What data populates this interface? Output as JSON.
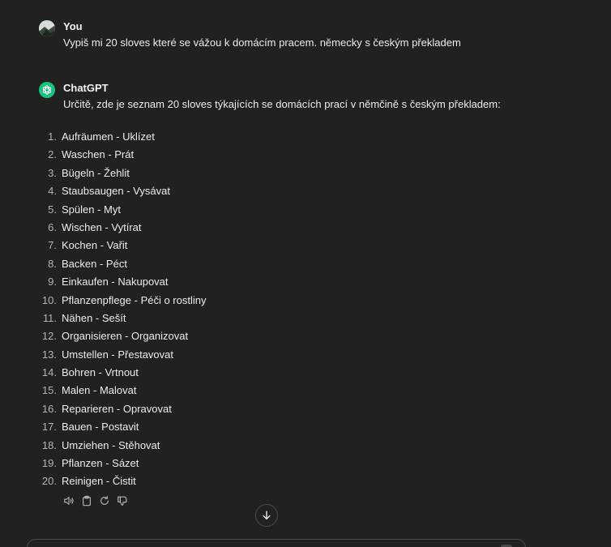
{
  "user_message": {
    "author": "You",
    "text": "Vypiš mi 20 sloves které se vážou k domácím pracem. německy s českým překladem"
  },
  "assistant_message": {
    "author": "ChatGPT",
    "intro": "Určitě, zde je seznam 20 sloves týkajících se domácích prací v němčině s českým překladem:",
    "items": [
      {
        "num": "1.",
        "text": "Aufräumen - Uklízet"
      },
      {
        "num": "2.",
        "text": "Waschen - Prát"
      },
      {
        "num": "3.",
        "text": "Bügeln - Žehlit"
      },
      {
        "num": "4.",
        "text": "Staubsaugen - Vysávat"
      },
      {
        "num": "5.",
        "text": "Spülen - Myt"
      },
      {
        "num": "6.",
        "text": "Wischen - Vytírat"
      },
      {
        "num": "7.",
        "text": "Kochen - Vařit"
      },
      {
        "num": "8.",
        "text": "Backen - Péct"
      },
      {
        "num": "9.",
        "text": "Einkaufen - Nakupovat"
      },
      {
        "num": "10.",
        "text": "Pflanzenpflege - Péči o rostliny"
      },
      {
        "num": "11.",
        "text": "Nähen - Sešít"
      },
      {
        "num": "12.",
        "text": "Organisieren - Organizovat"
      },
      {
        "num": "13.",
        "text": "Umstellen - Přestavovat"
      },
      {
        "num": "14.",
        "text": "Bohren - Vrtnout"
      },
      {
        "num": "15.",
        "text": "Malen - Malovat"
      },
      {
        "num": "16.",
        "text": "Reparieren - Opravovat"
      },
      {
        "num": "17.",
        "text": "Bauen - Postavit"
      },
      {
        "num": "18.",
        "text": "Umziehen - Stěhovat"
      },
      {
        "num": "19.",
        "text": "Pflanzen - Sázet"
      },
      {
        "num": "20.",
        "text": "Reinigen - Čistit"
      }
    ]
  },
  "actions": {
    "icons": [
      "speaker-icon",
      "clipboard-icon",
      "regenerate-icon",
      "thumbs-down-icon"
    ]
  },
  "colors": {
    "background": "#212121",
    "text": "#ececec",
    "muted": "#b4b4b4",
    "brand": "#19c37d"
  }
}
